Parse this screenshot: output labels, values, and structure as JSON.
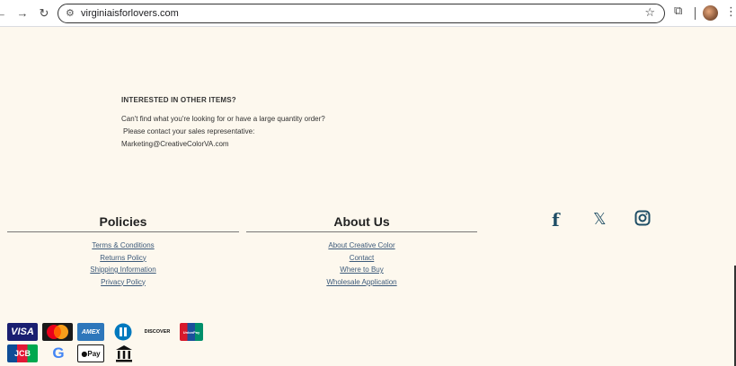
{
  "browser": {
    "url": "virginiaisforlovers.com",
    "back_icon": "back-arrow-icon",
    "forward_icon": "forward-arrow-icon",
    "reload_icon": "reload-icon"
  },
  "info": {
    "heading": "INTERESTED IN OTHER ITEMS?",
    "line1": "Can't find what you're looking for or have a large quantity order?",
    "line2": "Please contact your sales representative:",
    "email": "Marketing@CreativeColorVA.com"
  },
  "policies": {
    "title": "Policies",
    "links": [
      "Terms & Conditions",
      "Returns Policy",
      "Shipping Information",
      "Privacy Policy"
    ]
  },
  "about": {
    "title": "About Us",
    "links": [
      "About Creative Color",
      "Contact",
      "Where to Buy",
      "Wholesale Application"
    ]
  },
  "social": [
    "facebook-icon",
    "x-icon",
    "instagram-icon"
  ],
  "payments": {
    "visa": "VISA",
    "amex": "AMEX",
    "discover": "DISCOVER",
    "jcb": "JCB",
    "google": "G",
    "applepay": "Pay",
    "unionpay": "UnionPay"
  },
  "colors": {
    "background": "#fdf8ee",
    "link": "#3c5a7a",
    "social": "#1f4e66"
  }
}
